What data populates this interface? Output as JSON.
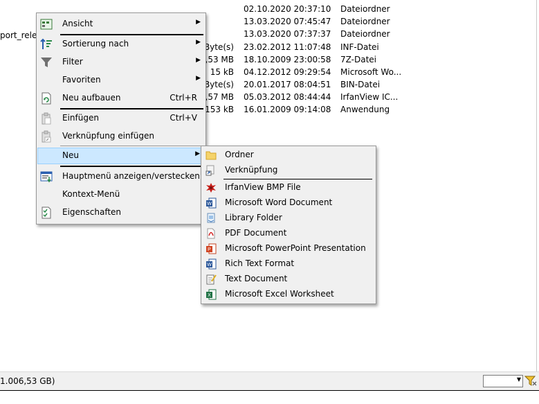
{
  "background": {
    "left_fragment": "port_relea",
    "rows": [
      {
        "size": "",
        "date": "02.10.2020 20:37:10",
        "type": "Dateiordner"
      },
      {
        "size": "",
        "date": "13.03.2020 07:45:47",
        "type": "Dateiordner"
      },
      {
        "size": "",
        "date": "13.03.2020 07:37:37",
        "type": "Dateiordner"
      },
      {
        "size": "Byte(s)",
        "date": "23.02.2012 11:07:48",
        "type": "INF-Datei"
      },
      {
        "size": "2,53 MB",
        "date": "18.10.2009 23:00:58",
        "type": "7Z-Datei"
      },
      {
        "size": "15 kB",
        "date": "04.12.2012 09:29:54",
        "type": "Microsoft Wo..."
      },
      {
        "size": "Byte(s)",
        "date": "20.01.2017 08:04:51",
        "type": "BIN-Datei"
      },
      {
        "size": ",57 MB",
        "date": "05.03.2012 08:44:44",
        "type": "IrfanView IC..."
      },
      {
        "size": "153 kB",
        "date": "16.01.2009 09:14:08",
        "type": "Anwendung"
      }
    ]
  },
  "context_menu": {
    "items": [
      {
        "label": "Ansicht",
        "icon": "view-icon",
        "shortcut": "",
        "submenu": true
      },
      {
        "label": "Sortierung nach",
        "icon": "sort-icon",
        "shortcut": "",
        "submenu": true
      },
      {
        "label": "Filter",
        "icon": "filter-icon",
        "shortcut": "",
        "submenu": true
      },
      {
        "label": "Favoriten",
        "icon": "",
        "shortcut": "",
        "submenu": true
      },
      {
        "label": "Neu aufbauen",
        "icon": "refresh-icon",
        "shortcut": "Ctrl+R",
        "submenu": false
      },
      {
        "label": "Einfügen",
        "icon": "paste-icon",
        "shortcut": "Ctrl+V",
        "submenu": false
      },
      {
        "label": "Verknüpfung einfügen",
        "icon": "paste-shortcut-icon",
        "shortcut": "",
        "submenu": false
      },
      {
        "label": "Neu",
        "icon": "",
        "shortcut": "",
        "submenu": true,
        "highlighted": true
      },
      {
        "label": "Hauptmenü anzeigen/verstecken",
        "icon": "menu-toggle-icon",
        "shortcut": "",
        "submenu": false
      },
      {
        "label": "Kontext-Menü",
        "icon": "",
        "shortcut": "",
        "submenu": false
      },
      {
        "label": "Eigenschaften",
        "icon": "properties-icon",
        "shortcut": "",
        "submenu": false
      }
    ]
  },
  "new_submenu": {
    "items": [
      {
        "label": "Ordner",
        "icon": "folder-icon"
      },
      {
        "label": "Verknüpfung",
        "icon": "shortcut-icon"
      },
      {
        "label": "IrfanView BMP File",
        "icon": "irfanview-icon"
      },
      {
        "label": "Microsoft Word Document",
        "icon": "word-icon"
      },
      {
        "label": "Library Folder",
        "icon": "library-icon"
      },
      {
        "label": "PDF Document",
        "icon": "pdf-icon"
      },
      {
        "label": "Microsoft PowerPoint Presentation",
        "icon": "powerpoint-icon"
      },
      {
        "label": "Rich Text Format",
        "icon": "rtf-icon"
      },
      {
        "label": "Text Document",
        "icon": "text-document-icon"
      },
      {
        "label": "Microsoft Excel Worksheet",
        "icon": "excel-icon"
      }
    ]
  },
  "status_bar": {
    "text": "1.006,53 GB)",
    "combo_value": ""
  },
  "colors": {
    "menu_bg": "#f0f0f0",
    "highlight_bg": "#cce8ff",
    "highlight_border": "#99d1ff"
  }
}
